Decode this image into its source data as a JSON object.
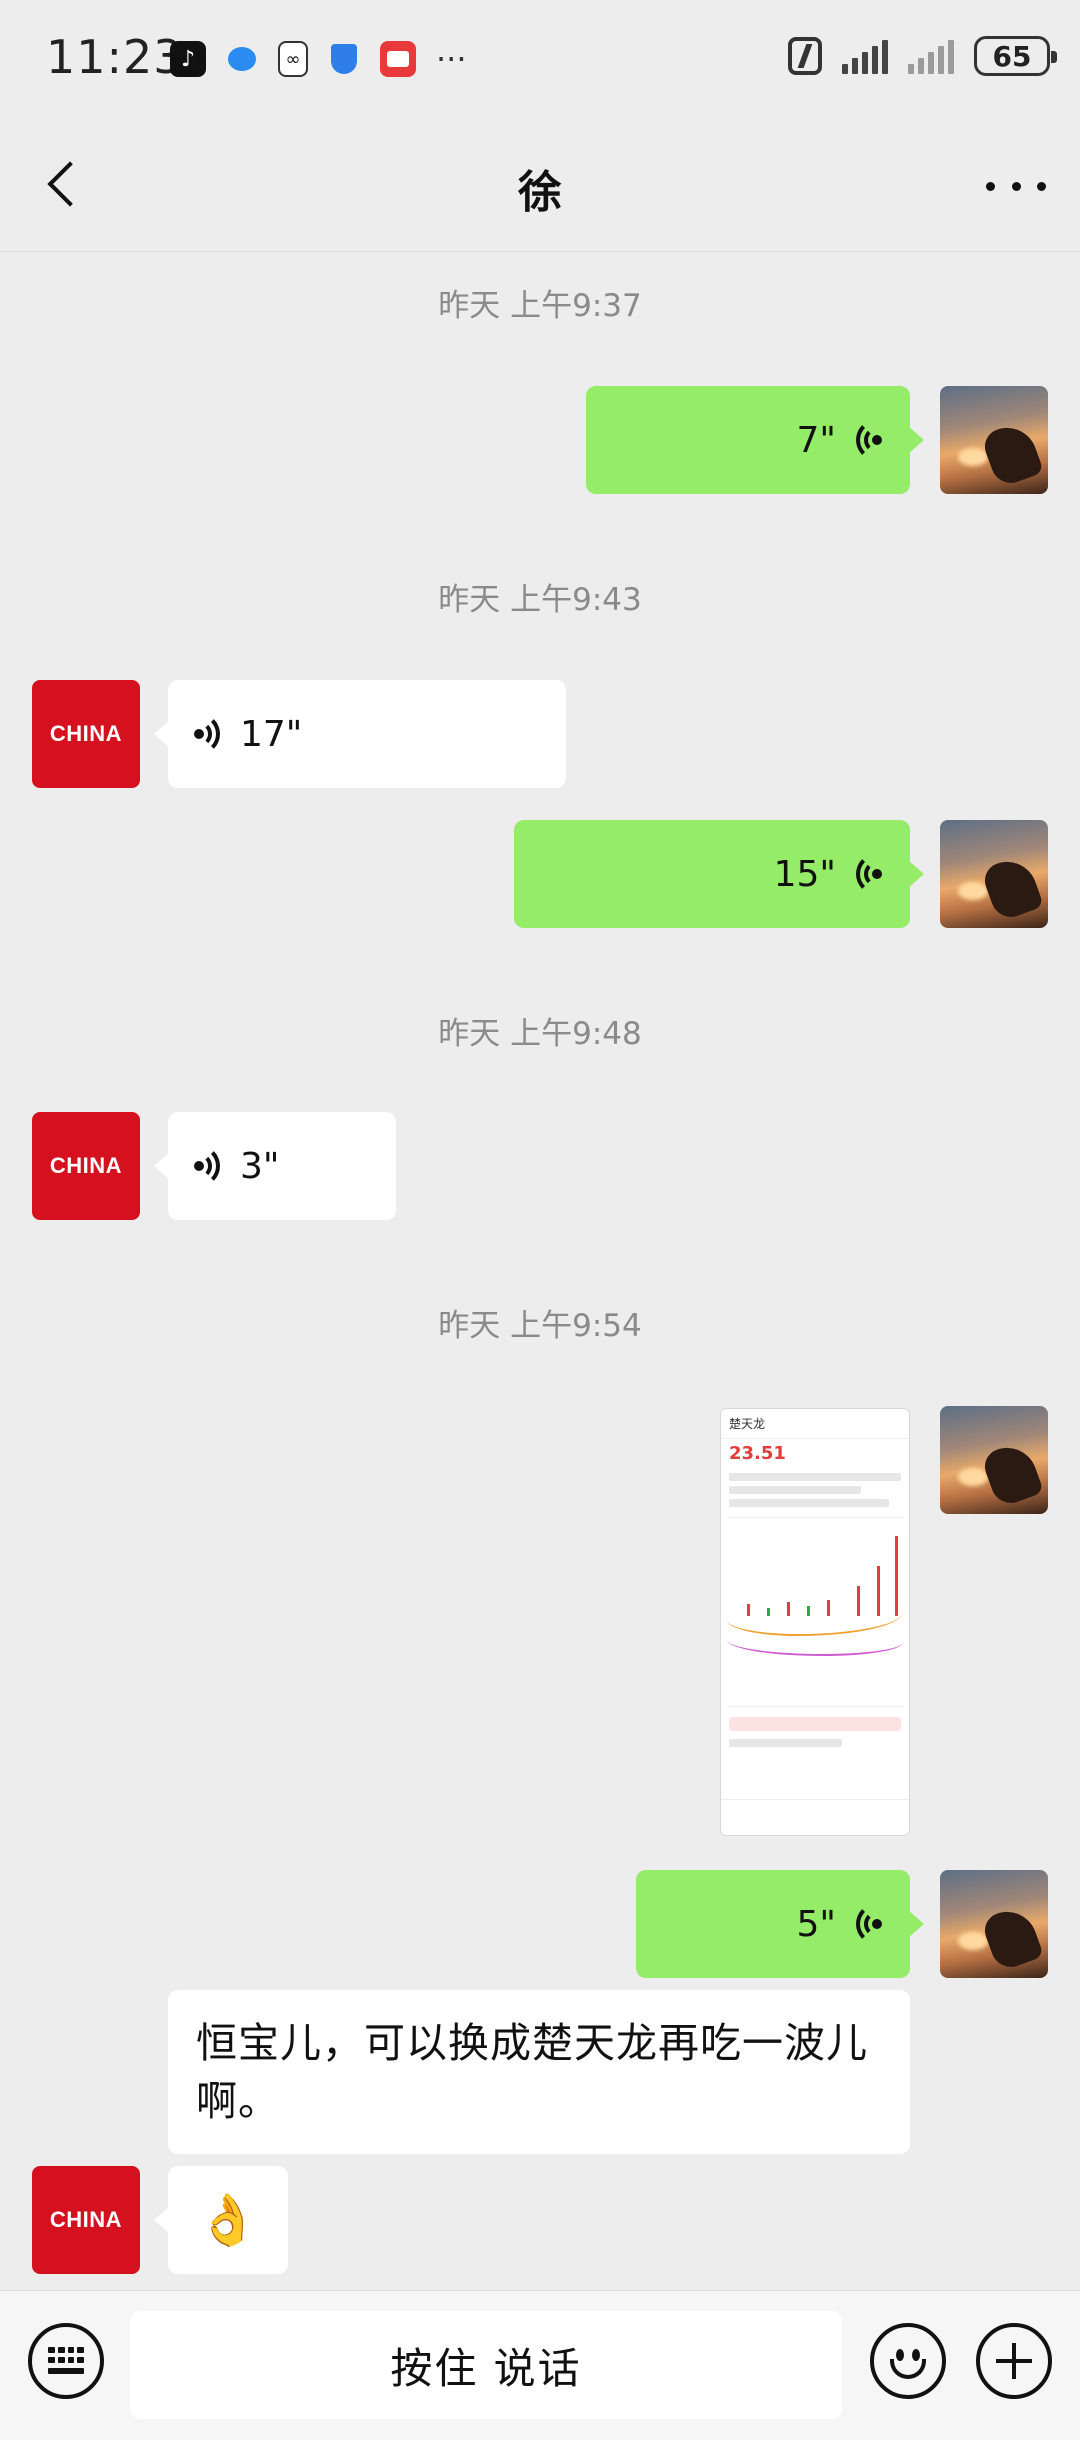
{
  "status_bar": {
    "time": "11:23",
    "battery": "65",
    "notification_icons": [
      "tiktok-icon",
      "message-bubble-icon",
      "link-icon",
      "shield-icon",
      "red-app-icon",
      "more-notifications-icon"
    ],
    "more_glyph": "···"
  },
  "header": {
    "title": "徐"
  },
  "messages": [
    {
      "type": "timestamp",
      "text": "昨天 上午9:37"
    },
    {
      "type": "voice",
      "side": "self",
      "duration": "7\""
    },
    {
      "type": "timestamp",
      "text": "昨天 上午9:43"
    },
    {
      "type": "voice",
      "side": "other",
      "duration": "17\""
    },
    {
      "type": "voice",
      "side": "self",
      "duration": "15\""
    },
    {
      "type": "timestamp",
      "text": "昨天 上午9:48"
    },
    {
      "type": "voice",
      "side": "other",
      "duration": "3\""
    },
    {
      "type": "timestamp",
      "text": "昨天 上午9:54"
    },
    {
      "type": "image",
      "side": "self",
      "stock_name": "楚天龙",
      "price": "23.51"
    },
    {
      "type": "voice",
      "side": "self",
      "duration": "5\""
    },
    {
      "type": "text",
      "side": "other",
      "text": "恒宝儿，可以换成楚天龙再吃一波儿啊。"
    },
    {
      "type": "emoji",
      "side": "other",
      "emoji": "👌"
    }
  ],
  "avatars": {
    "other_label": "CHINA"
  },
  "input_bar": {
    "hold_to_talk": "按住 说话"
  },
  "colors": {
    "self_bubble": "#95ec69",
    "other_bubble": "#ffffff",
    "background": "#ededed",
    "avatar_other": "#d6111f"
  }
}
